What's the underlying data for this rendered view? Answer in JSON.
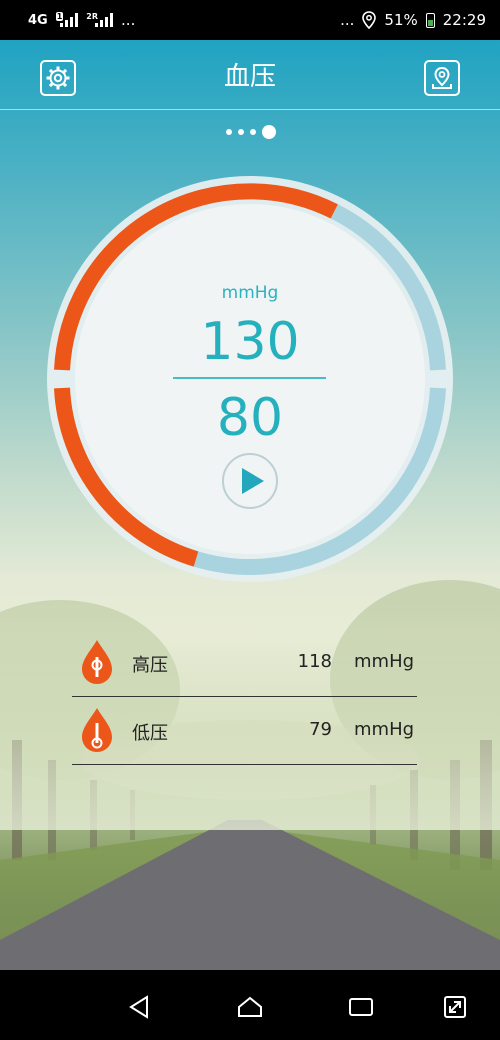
{
  "status_bar": {
    "network": "4G",
    "sim1_badge": "1",
    "sim2_badge": "2R",
    "left_overflow": "...",
    "right_overflow": "...",
    "battery": "51%",
    "time": "22:29"
  },
  "header": {
    "title": "血压",
    "settings_icon": "gear-icon",
    "location_icon": "map-pin-icon"
  },
  "pager": {
    "count": 4,
    "active_index": 3
  },
  "gauge": {
    "unit": "mmHg",
    "systolic": "130",
    "diastolic": "80",
    "play_icon": "play-icon",
    "colors": {
      "accent": "#ec5618",
      "track": "#a9d4df",
      "text": "#25b0bd"
    }
  },
  "readings": [
    {
      "label": "高压",
      "value": "118",
      "unit": "mmHg",
      "icon": "blood-drop-high-icon"
    },
    {
      "label": "低压",
      "value": "79",
      "unit": "mmHg",
      "icon": "blood-drop-low-icon"
    }
  ],
  "nav": {
    "back_icon": "back-triangle-icon",
    "home_icon": "home-icon",
    "recents_icon": "recents-icon",
    "extra_icon": "expand-icon"
  }
}
